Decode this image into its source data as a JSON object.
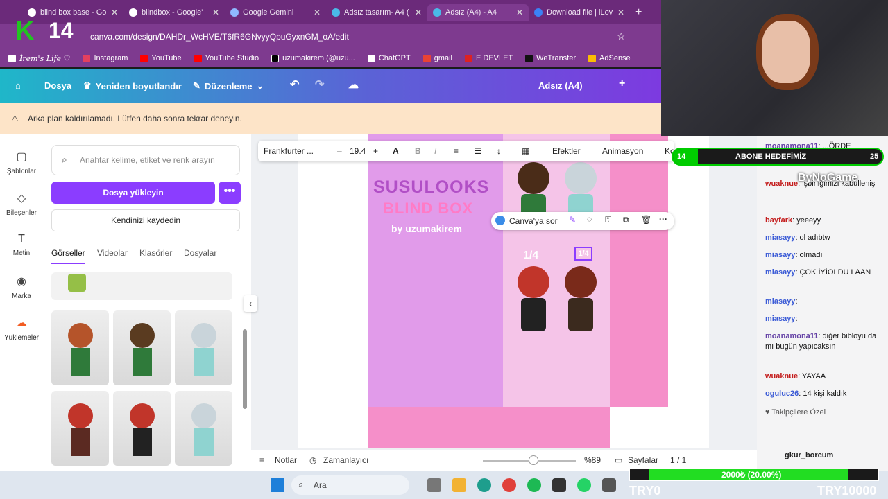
{
  "browser": {
    "tabs": [
      {
        "label": "blind box base - Go"
      },
      {
        "label": "blindbox - Google'"
      },
      {
        "label": "Google Gemini"
      },
      {
        "label": "Adsız tasarım- A4 ("
      },
      {
        "label": "Adsız (A4) - A4"
      },
      {
        "label": "Download file | iLov"
      }
    ],
    "new_tab": "+",
    "url": "canva.com/design/DAHDr_WcHVE/T6fR6GNvyyQpuGyxnGM_oA/edit",
    "bookmarks": [
      "İrem's Life ♡",
      "Instagram",
      "YouTube",
      "YouTube Studio",
      "uzumakirem (@uzu...",
      "ChatGPT",
      "gmail",
      "E DEVLET",
      "WeTransfer",
      "AdSense"
    ]
  },
  "canva_header": {
    "file": "Dosya",
    "resize": "Yeniden boyutlandır",
    "edit": "Düzenleme",
    "doc_title": "Adsız (A4)"
  },
  "banner": {
    "text": "Arka plan kaldırılamadı. Lütfen daha sonra tekrar deneyin."
  },
  "left_nav": {
    "items": [
      "Şablonlar",
      "Bileşenler",
      "Metin",
      "Marka",
      "Yüklemeler"
    ]
  },
  "panel": {
    "search_placeholder": "Anahtar kelime, etiket ve renk arayın",
    "upload": "Dosya yükleyin",
    "more": "•••",
    "record": "Kendinizi kaydedin",
    "tabs": [
      "Görseller",
      "Videolar",
      "Klasörler",
      "Dosyalar"
    ]
  },
  "toolbar": {
    "font": "Frankfurter ...",
    "minus": "–",
    "size": "19.4",
    "plus": "+",
    "bold": "B",
    "italic": "I",
    "effects": "Efektler",
    "animation": "Animasyon",
    "cut": "Ko"
  },
  "canvas": {
    "title1": "SUSULOOKS",
    "title2": "BLIND BOX",
    "subtitle": "by uzumakirem",
    "ratio1": "1/4",
    "ratio2": "1/4",
    "ask": "Canva'ya sor"
  },
  "bottom_bar": {
    "notes": "Notlar",
    "timer": "Zamanlayıcı",
    "zoom": "%89",
    "pages": "Sayfalar",
    "page_count": "1 / 1"
  },
  "overlay": {
    "k_logo": "K",
    "level": "14",
    "goal_level": "14",
    "goal_label": "ABONE HEDEFİMİZ",
    "goal_count": "25",
    "progress_label": "2000₺ (20.00%)",
    "progress": 0.2,
    "try_left": "TRY0",
    "try_right": "TRY10000",
    "brand": "ByNoGame"
  },
  "chat": {
    "messages": [
      {
        "user": "moanamona11",
        "text": ": ...ÖRDE 8CWMFW"
      },
      {
        "user": "wuaknue",
        "text": ": işbirliğimizi kabulleniş"
      },
      {
        "user": "bayfark",
        "text": ": yeeeyy"
      },
      {
        "user": "miasayy",
        "text": ": ol adıbtw"
      },
      {
        "user": "miasayy",
        "text": ": olmadı"
      },
      {
        "user": "miasayy",
        "text": ": ÇOK İYİOLDU LAAN"
      },
      {
        "user": "miasayy",
        "text": ":"
      },
      {
        "user": "miasayy",
        "text": ":"
      },
      {
        "user": "moanamona11",
        "text": ": diğer bibloyu da mı bugün yapıcaksın"
      },
      {
        "user": "wuaknue",
        "text": ": YAYAA"
      },
      {
        "user": "oguluc26",
        "text": ": 14 kişi kaldık"
      }
    ],
    "followers_special": "Takipçilere Özel",
    "bottom_label": "gkur_borcum"
  },
  "taskbar": {
    "search": "Ara"
  }
}
